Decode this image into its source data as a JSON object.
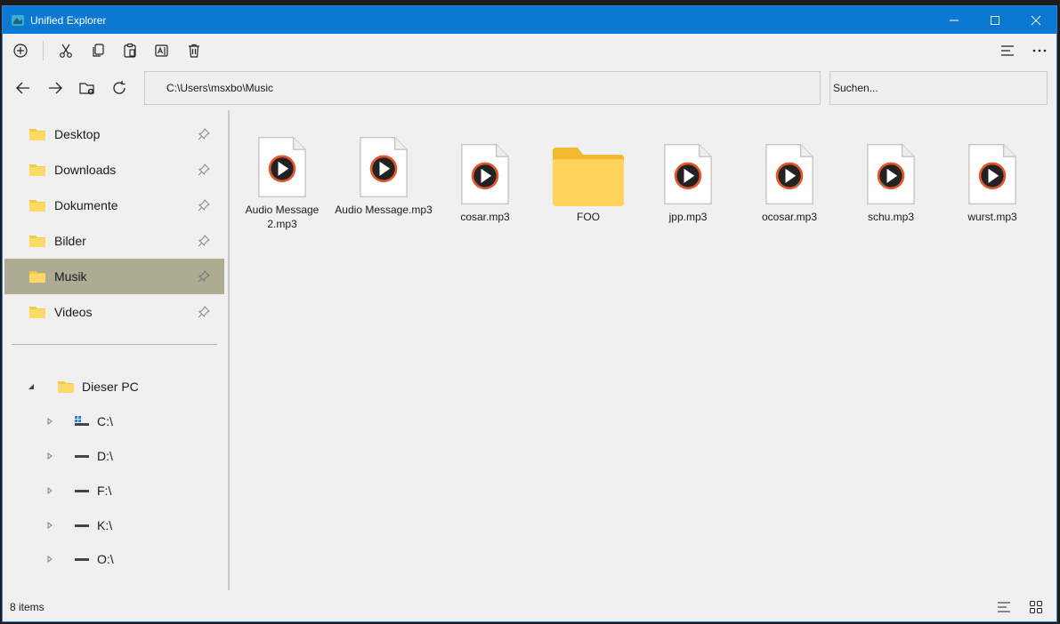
{
  "window": {
    "title": "Unified Explorer",
    "accent": "#0b78d4"
  },
  "toolbar": {
    "icons": [
      "new-icon",
      "cut-icon",
      "copy-icon",
      "paste-icon",
      "rename-icon",
      "delete-icon",
      "view-menu-icon",
      "more-icon"
    ]
  },
  "nav": {
    "address": "C:\\Users\\msxbo\\Music",
    "search_placeholder": "Suchen..."
  },
  "sidebar": {
    "favorites": [
      {
        "label": "Desktop",
        "selected": false
      },
      {
        "label": "Downloads",
        "selected": false
      },
      {
        "label": "Dokumente",
        "selected": false
      },
      {
        "label": "Bilder",
        "selected": false
      },
      {
        "label": "Musik",
        "selected": true
      },
      {
        "label": "Videos",
        "selected": false
      }
    ],
    "tree": {
      "root": "Dieser PC",
      "drives": [
        "C:\\",
        "D:\\",
        "F:\\",
        "K:\\",
        "O:\\"
      ]
    }
  },
  "files": [
    {
      "name": "Audio Message 2.mp3",
      "type": "audio"
    },
    {
      "name": "Audio Message.mp3",
      "type": "audio"
    },
    {
      "name": "cosar.mp3",
      "type": "audio"
    },
    {
      "name": "FOO",
      "type": "folder"
    },
    {
      "name": "jpp.mp3",
      "type": "audio"
    },
    {
      "name": "ocosar.mp3",
      "type": "audio"
    },
    {
      "name": "schu.mp3",
      "type": "audio"
    },
    {
      "name": "wurst.mp3",
      "type": "audio"
    }
  ],
  "status": {
    "count": "8 items"
  }
}
